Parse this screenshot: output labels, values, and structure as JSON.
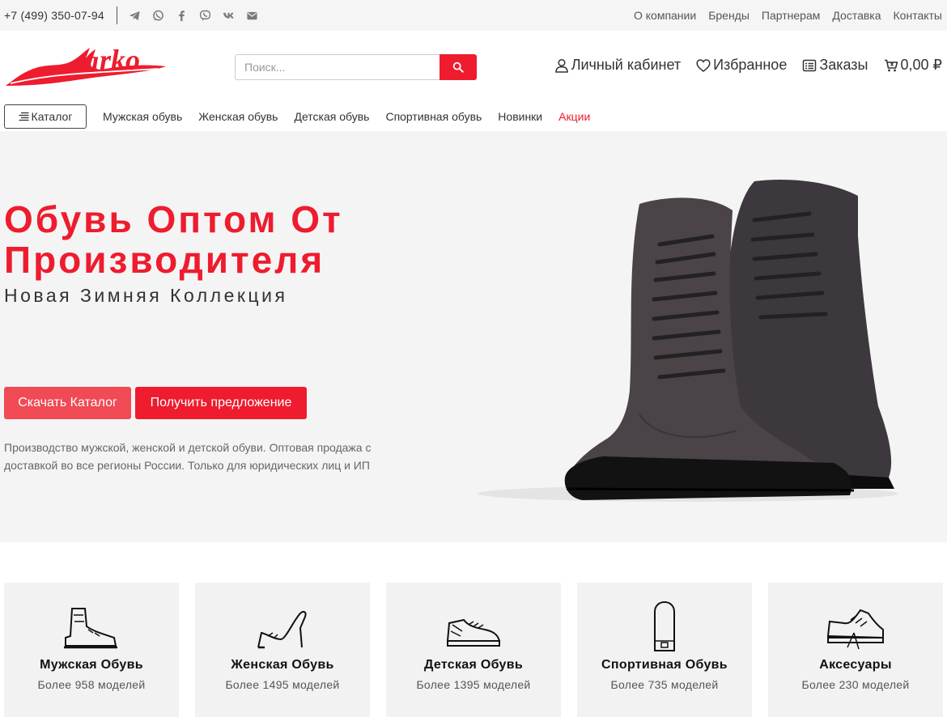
{
  "topbar": {
    "phone": "+7 (499) 350-07-94",
    "social_icons": [
      "telegram-icon",
      "whatsapp-icon",
      "facebook-icon",
      "viber-icon",
      "vk-icon",
      "mail-icon"
    ],
    "links": [
      "О компании",
      "Бренды",
      "Партнерам",
      "Доставка",
      "Контакты"
    ]
  },
  "header": {
    "logo_text": "Marko",
    "search_placeholder": "Поиск...",
    "account": "Личный кабинет",
    "favorites": "Избранное",
    "orders": "Заказы",
    "cart_total": "0,00 ₽"
  },
  "nav": {
    "catalog": "Каталог",
    "links": [
      "Мужская обувь",
      "Женская обувь",
      "Детская обувь",
      "Спортивная обувь",
      "Новинки"
    ],
    "sale": "Акции"
  },
  "hero": {
    "title_line1": "Обувь Оптом От",
    "title_line2": "Производителя",
    "subtitle": "Новая Зимняя Коллекция",
    "btn_download": "Скачать Каталог",
    "btn_offer": "Получить предложение",
    "description": "Производство мужской, женской и детской обуви. Оптовая продажа с доставкой во все регионы России. Только для юридических лиц и ИП"
  },
  "categories": [
    {
      "title": "Мужская Обувь",
      "count": "Более 958 моделей",
      "icon": "mens-boot-icon"
    },
    {
      "title": "Женская Обувь",
      "count": "Более 1495 моделей",
      "icon": "high-heel-icon"
    },
    {
      "title": "Детская Обувь",
      "count": "Более 1395 моделей",
      "icon": "kids-sneaker-icon"
    },
    {
      "title": "Спортивная Обувь",
      "count": "Более 735 моделей",
      "icon": "sport-shoe-icon"
    },
    {
      "title": "Аксесуары",
      "count": "Более 230 моделей",
      "icon": "accessories-icon"
    }
  ],
  "colors": {
    "brand_red": "#ee1c2e",
    "light_red": "#f04a55",
    "bg_gray": "#f4f4f4"
  }
}
